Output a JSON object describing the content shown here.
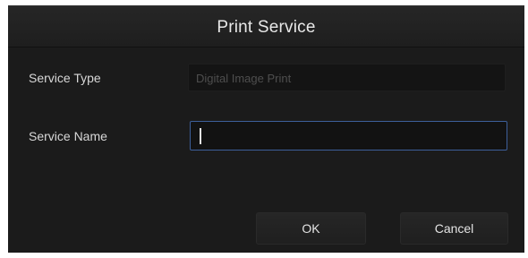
{
  "dialog": {
    "title": "Print Service",
    "service_type": {
      "label": "Service Type",
      "value": "Digital Image Print"
    },
    "service_name": {
      "label": "Service Name",
      "value": "",
      "placeholder": ""
    },
    "buttons": {
      "ok": "OK",
      "cancel": "Cancel"
    }
  },
  "colors": {
    "dialog_background": "#1b1b1b",
    "focus_border": "#3d5f9a"
  }
}
